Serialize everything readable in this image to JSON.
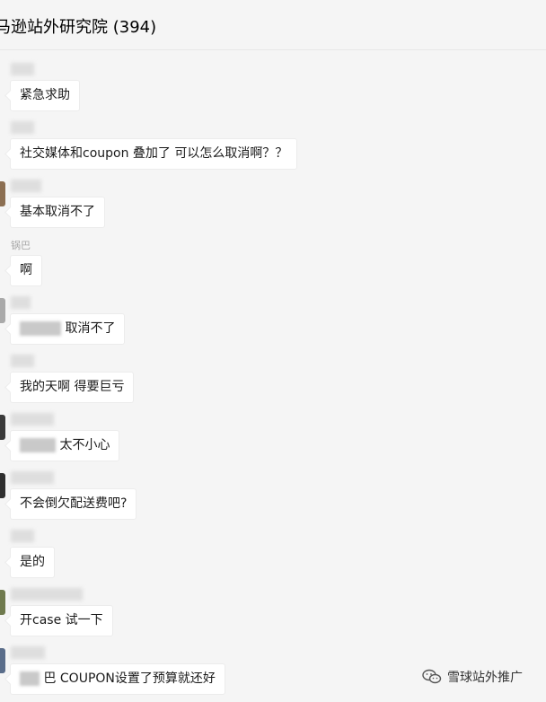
{
  "header": {
    "title": "马逊站外研究院 (394)"
  },
  "messages": [
    {
      "sender": "",
      "text": "紧急求助"
    },
    {
      "sender": "",
      "text": "社交媒体和coupon 叠加了  可以怎么取消啊？？"
    },
    {
      "sender": "",
      "text": "基本取消不了"
    },
    {
      "sender": "锅巴",
      "text": "啊"
    },
    {
      "sender": "",
      "text": "取消不了"
    },
    {
      "sender": "",
      "text": "我的天啊 得要巨亏"
    },
    {
      "sender": "",
      "text": "太不小心"
    },
    {
      "sender": "",
      "text": "不会倒欠配送费吧?"
    },
    {
      "sender": "",
      "text": "是的"
    },
    {
      "sender": "",
      "text": "开case 试一下"
    },
    {
      "sender": "",
      "text": "巴 COUPON设置了预算就还好"
    }
  ],
  "watermark": {
    "text": "雪球站外推广",
    "icon": "wechat-icon"
  }
}
